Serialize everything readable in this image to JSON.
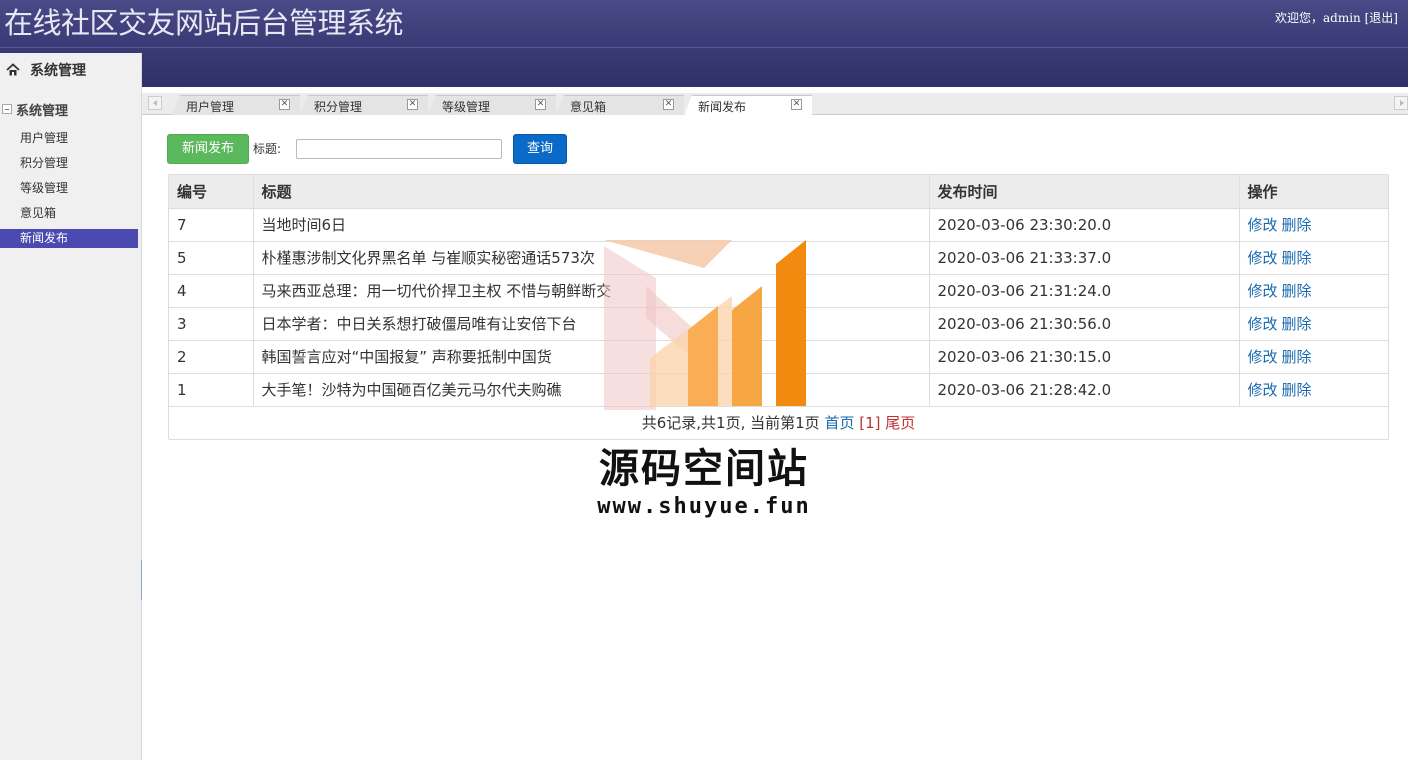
{
  "header": {
    "title": "在线社区交友网站后台管理系统",
    "welcome": "欢迎您，admin",
    "logout": "[退出]"
  },
  "sidebar": {
    "tab_label": "系统管理",
    "group_label": "系统管理",
    "items": [
      {
        "label": "用户管理"
      },
      {
        "label": "积分管理"
      },
      {
        "label": "等级管理"
      },
      {
        "label": "意见箱"
      },
      {
        "label": "新闻发布"
      }
    ],
    "active_index": 4
  },
  "tabs": [
    {
      "label": "用户管理"
    },
    {
      "label": "积分管理"
    },
    {
      "label": "等级管理"
    },
    {
      "label": "意见箱"
    },
    {
      "label": "新闻发布"
    }
  ],
  "toolbar": {
    "add_label": "新闻发布",
    "search_label": "标题:",
    "search_value": "",
    "query_label": "查询"
  },
  "table": {
    "headers": [
      "编号",
      "标题",
      "发布时间",
      "操作"
    ],
    "rows": [
      {
        "id": "7",
        "title": "当地时间6日",
        "time": "2020-03-06 23:30:20.0"
      },
      {
        "id": "5",
        "title": "朴槿惠涉制文化界黑名单 与崔顺实秘密通话573次",
        "time": "2020-03-06 21:33:37.0"
      },
      {
        "id": "4",
        "title": "马来西亚总理：用一切代价捍卫主权 不惜与朝鲜断交",
        "time": "2020-03-06 21:31:24.0"
      },
      {
        "id": "3",
        "title": "日本学者：中日关系想打破僵局唯有让安倍下台",
        "time": "2020-03-06 21:30:56.0"
      },
      {
        "id": "2",
        "title": "韩国誓言应对“中国报复” 声称要抵制中国货",
        "time": "2020-03-06 21:30:15.0"
      },
      {
        "id": "1",
        "title": "大手笔！沙特为中国砸百亿美元马尔代夫购礁",
        "time": "2020-03-06 21:28:42.0"
      }
    ],
    "edit_label": "修改",
    "delete_label": "删除"
  },
  "pager": {
    "summary": "共6记录,共1页, 当前第1页",
    "first": "首页",
    "current": "[1]",
    "last": "尾页"
  },
  "watermark": {
    "name": "源码空间站",
    "url": "www.shuyue.fun"
  },
  "colors": {
    "header_bg": "#3c3c78",
    "active_menu": "#4a4ab0",
    "add_button": "#5cb85c",
    "query_button": "#0a6ac8",
    "link": "#1a6ab0",
    "watermark_orange": "#f39a2a"
  }
}
